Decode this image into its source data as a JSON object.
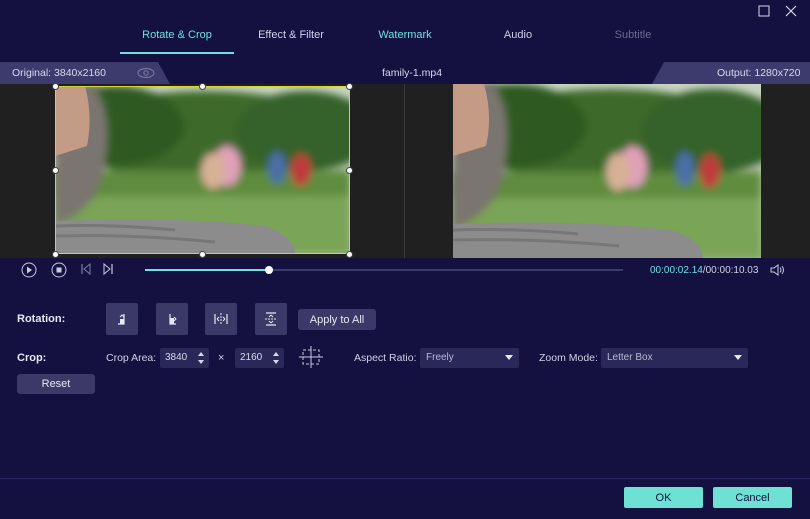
{
  "tabs": [
    {
      "label": "Rotate & Crop"
    },
    {
      "label": "Effect & Filter"
    },
    {
      "label": "Watermark"
    },
    {
      "label": "Audio"
    },
    {
      "label": "Subtitle"
    }
  ],
  "info": {
    "original": "Original: 3840x2160",
    "filename": "family-1.mp4",
    "output": "Output: 1280x720"
  },
  "player": {
    "current_time": "00:00:02.14",
    "total_time": "/00:00:10.03",
    "progress": 0.26
  },
  "rotation": {
    "label": "Rotation:",
    "apply_all": "Apply to All"
  },
  "crop": {
    "label": "Crop:",
    "area_label": "Crop Area:",
    "width": "3840",
    "times": "×",
    "height": "2160",
    "aspect_label": "Aspect Ratio:",
    "aspect_value": "Freely",
    "zoom_label": "Zoom Mode:",
    "zoom_value": "Letter Box",
    "reset": "Reset"
  },
  "footer": {
    "ok": "OK",
    "cancel": "Cancel"
  },
  "colors": {
    "background": "#14103f",
    "accent": "#6ee0e0",
    "crop_border": "#d6d23a"
  }
}
